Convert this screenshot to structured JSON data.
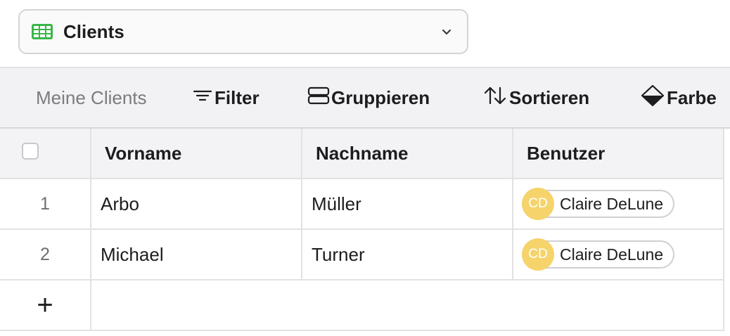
{
  "table_selector": {
    "name": "Clients",
    "icon": "grid-table-icon",
    "icon_color": "#3bb54a"
  },
  "toolbar": {
    "view_name": "Meine Clients",
    "filter_label": "Filter",
    "group_label": "Gruppieren",
    "sort_label": "Sortieren",
    "color_label": "Farbe"
  },
  "grid": {
    "columns": [
      "Vorname",
      "Nachname",
      "Benutzer"
    ],
    "rows": [
      {
        "num": "1",
        "vorname": "Arbo",
        "nachname": "Müller",
        "user": {
          "initials": "CD",
          "name": "Claire DeLune"
        }
      },
      {
        "num": "2",
        "vorname": "Michael",
        "nachname": "Turner",
        "user": {
          "initials": "CD",
          "name": "Claire DeLune"
        }
      }
    ],
    "add_row_symbol": "+"
  },
  "colors": {
    "avatar_bg": "#f6d36b",
    "toolbar_bg": "#f2f2f4",
    "accent_green": "#3bb54a"
  }
}
